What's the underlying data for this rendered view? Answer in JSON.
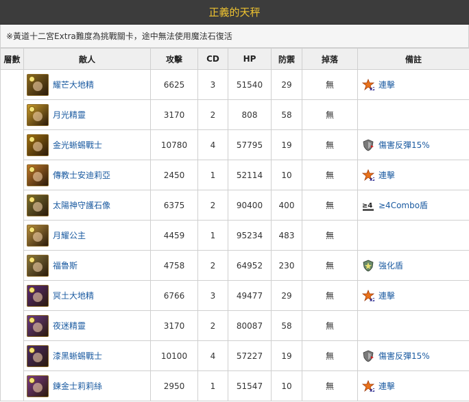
{
  "page_title": "正義的天秤",
  "note": "※黃道十二宮Extra難度為挑戰關卡，途中無法使用魔法石復活",
  "headers": {
    "floor": "層數",
    "enemy": "敵人",
    "attack": "攻擊",
    "cd": "CD",
    "hp": "HP",
    "defense": "防禦",
    "drop": "掉落",
    "remark": "備註"
  },
  "colors": {
    "title_bg": "#3c3c3c",
    "title_text": "#f0c430",
    "link": "#1a5aa0",
    "header_bg": "#efefef",
    "border": "#cfcfcf"
  },
  "rows": [
    {
      "name": "耀芒大地精",
      "attack": "6625",
      "cd": "3",
      "hp": "51540",
      "defense": "29",
      "drop": "無",
      "remark": "連擊",
      "remark_icon": "combo-x2-icon",
      "portrait_color": "#8a6a20"
    },
    {
      "name": "月光精靈",
      "attack": "3170",
      "cd": "2",
      "hp": "808",
      "defense": "58",
      "drop": "無",
      "remark": "",
      "remark_icon": "",
      "portrait_color": "#c89a2a"
    },
    {
      "name": "金光蜥蜴戰士",
      "attack": "10780",
      "cd": "4",
      "hp": "57795",
      "defense": "19",
      "drop": "無",
      "remark": "傷害反彈15%",
      "remark_icon": "damage-reflect-shield-icon",
      "portrait_color": "#a07010"
    },
    {
      "name": "傳教士安迪莉亞",
      "attack": "2450",
      "cd": "1",
      "hp": "52114",
      "defense": "10",
      "drop": "無",
      "remark": "連擊",
      "remark_icon": "combo-x2-icon",
      "portrait_color": "#c0782a"
    },
    {
      "name": "太陽神守護石像",
      "attack": "6375",
      "cd": "2",
      "hp": "90400",
      "defense": "400",
      "drop": "無",
      "remark": "≥4Combo盾",
      "remark_icon": "combo-shield-4-icon",
      "portrait_color": "#7a7030"
    },
    {
      "name": "月耀公主",
      "attack": "4459",
      "cd": "1",
      "hp": "95234",
      "defense": "483",
      "drop": "無",
      "remark": "",
      "remark_icon": "",
      "portrait_color": "#b89040"
    },
    {
      "name": "福魯斯",
      "attack": "4758",
      "cd": "2",
      "hp": "64952",
      "defense": "230",
      "drop": "無",
      "remark": "強化盾",
      "remark_icon": "reinforced-shield-icon",
      "portrait_color": "#8a7a40"
    },
    {
      "name": "冥土大地精",
      "attack": "6766",
      "cd": "3",
      "hp": "49477",
      "defense": "29",
      "drop": "無",
      "remark": "連擊",
      "remark_icon": "combo-x2-icon",
      "portrait_color": "#5a2a7a"
    },
    {
      "name": "夜迷精靈",
      "attack": "3170",
      "cd": "2",
      "hp": "80087",
      "defense": "58",
      "drop": "無",
      "remark": "",
      "remark_icon": "",
      "portrait_color": "#6a3a8a"
    },
    {
      "name": "漆黑蜥蜴戰士",
      "attack": "10100",
      "cd": "4",
      "hp": "57227",
      "defense": "19",
      "drop": "無",
      "remark": "傷害反彈15%",
      "remark_icon": "damage-reflect-shield-icon",
      "portrait_color": "#4a2a6a"
    },
    {
      "name": "鍊金士莉莉絲",
      "attack": "2950",
      "cd": "1",
      "hp": "51547",
      "defense": "10",
      "drop": "無",
      "remark": "連擊",
      "remark_icon": "combo-x2-icon",
      "portrait_color": "#7a3a8a"
    }
  ]
}
